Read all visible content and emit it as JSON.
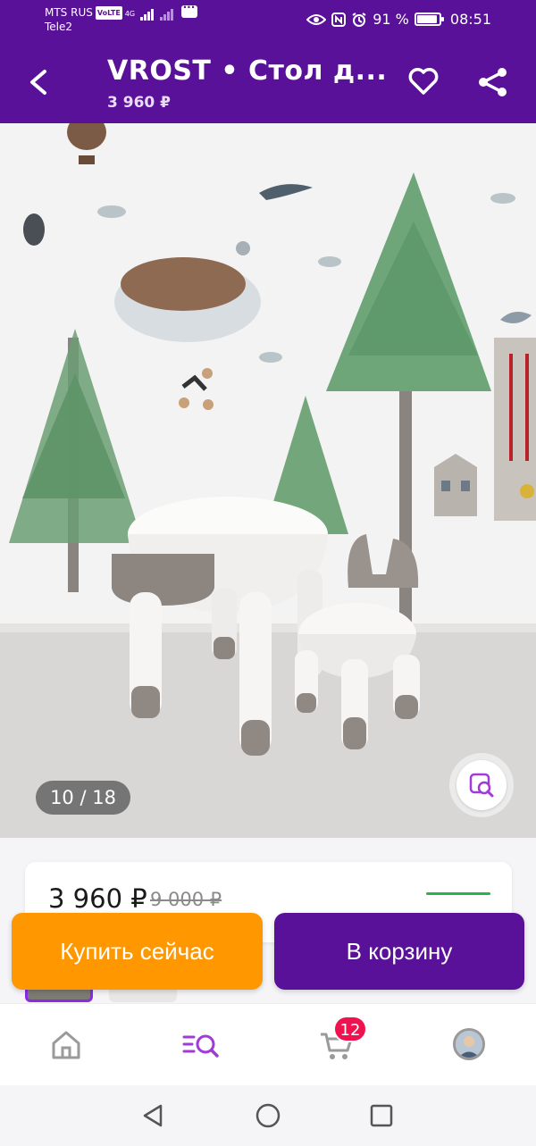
{
  "status_bar": {
    "carrier1": "MTS RUS",
    "volte": "VoLTE",
    "network": "4G",
    "carrier2": "Tele2",
    "battery_percent": "91 %",
    "battery_level": 0.91,
    "time": "08:51"
  },
  "header": {
    "title": "VROST  •  Стол д...",
    "price": "3 960 ₽"
  },
  "gallery": {
    "counter": "10 / 18",
    "current": 10,
    "total": 18
  },
  "price_card": {
    "price": "3 960 ₽",
    "old_price": "9 000 ₽"
  },
  "actions": {
    "buy_now": "Купить сейчас",
    "add_to_cart": "В корзину"
  },
  "bottom_nav": {
    "items": [
      {
        "icon": "home-icon"
      },
      {
        "icon": "catalog-search-icon"
      },
      {
        "icon": "cart-icon"
      },
      {
        "icon": "profile-avatar"
      }
    ],
    "cart_badge": "12"
  },
  "colors": {
    "brand_purple": "#5a1199",
    "buy_orange": "#ff9800",
    "badge_red": "#f0124e",
    "green_accent": "#2bb24c"
  },
  "system_nav": {
    "items": [
      {
        "icon": "back-triangle-icon"
      },
      {
        "icon": "home-circle-icon"
      },
      {
        "icon": "recents-square-icon"
      }
    ]
  }
}
